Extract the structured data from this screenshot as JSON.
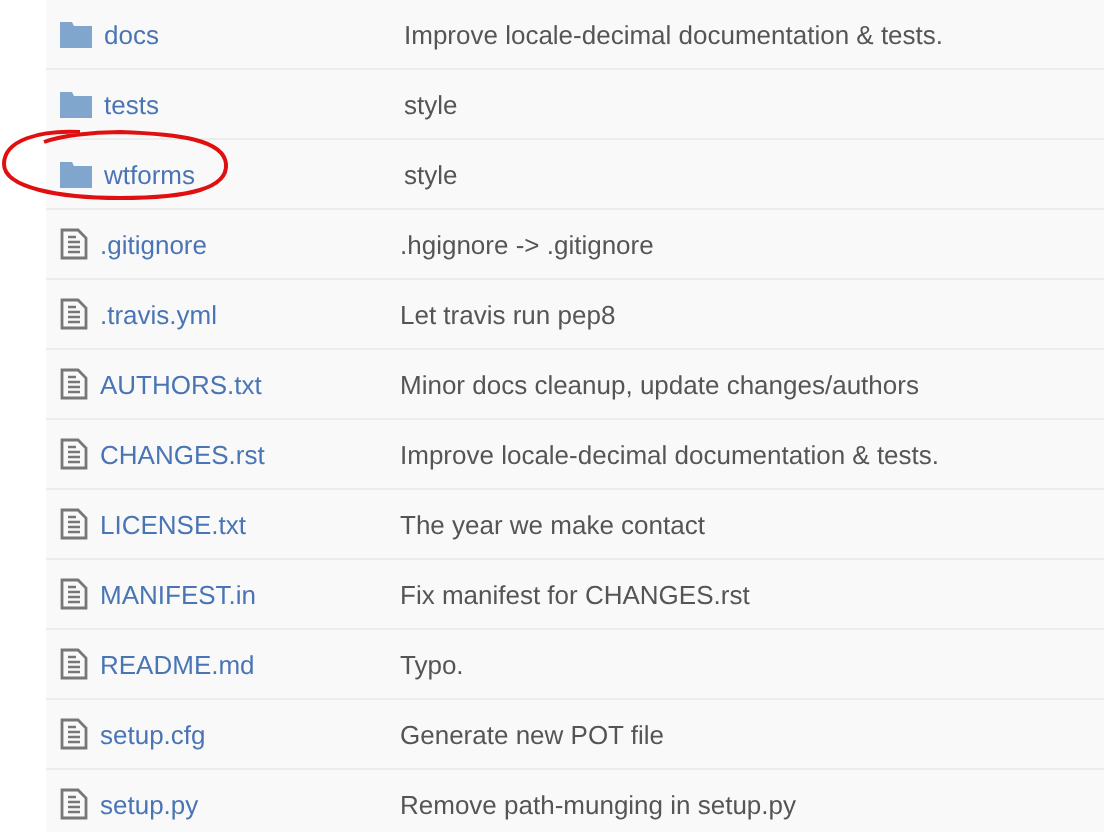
{
  "files": [
    {
      "kind": "folder",
      "name": "docs",
      "message": "Improve locale-decimal documentation & tests.",
      "circled": false
    },
    {
      "kind": "folder",
      "name": "tests",
      "message": "style",
      "circled": false
    },
    {
      "kind": "folder",
      "name": "wtforms",
      "message": "style",
      "circled": true
    },
    {
      "kind": "file",
      "name": ".gitignore",
      "message": ".hgignore -> .gitignore",
      "circled": false
    },
    {
      "kind": "file",
      "name": ".travis.yml",
      "message": "Let travis run pep8",
      "circled": false
    },
    {
      "kind": "file",
      "name": "AUTHORS.txt",
      "message": "Minor docs cleanup, update changes/authors",
      "circled": false
    },
    {
      "kind": "file",
      "name": "CHANGES.rst",
      "message": "Improve locale-decimal documentation & tests.",
      "circled": false
    },
    {
      "kind": "file",
      "name": "LICENSE.txt",
      "message": "The year we make contact",
      "circled": false
    },
    {
      "kind": "file",
      "name": "MANIFEST.in",
      "message": "Fix manifest for CHANGES.rst",
      "circled": false
    },
    {
      "kind": "file",
      "name": "README.md",
      "message": "Typo.",
      "circled": false
    },
    {
      "kind": "file",
      "name": "setup.cfg",
      "message": "Generate new POT file",
      "circled": false
    },
    {
      "kind": "file",
      "name": "setup.py",
      "message": "Remove path-munging in setup.py",
      "circled": false
    }
  ]
}
